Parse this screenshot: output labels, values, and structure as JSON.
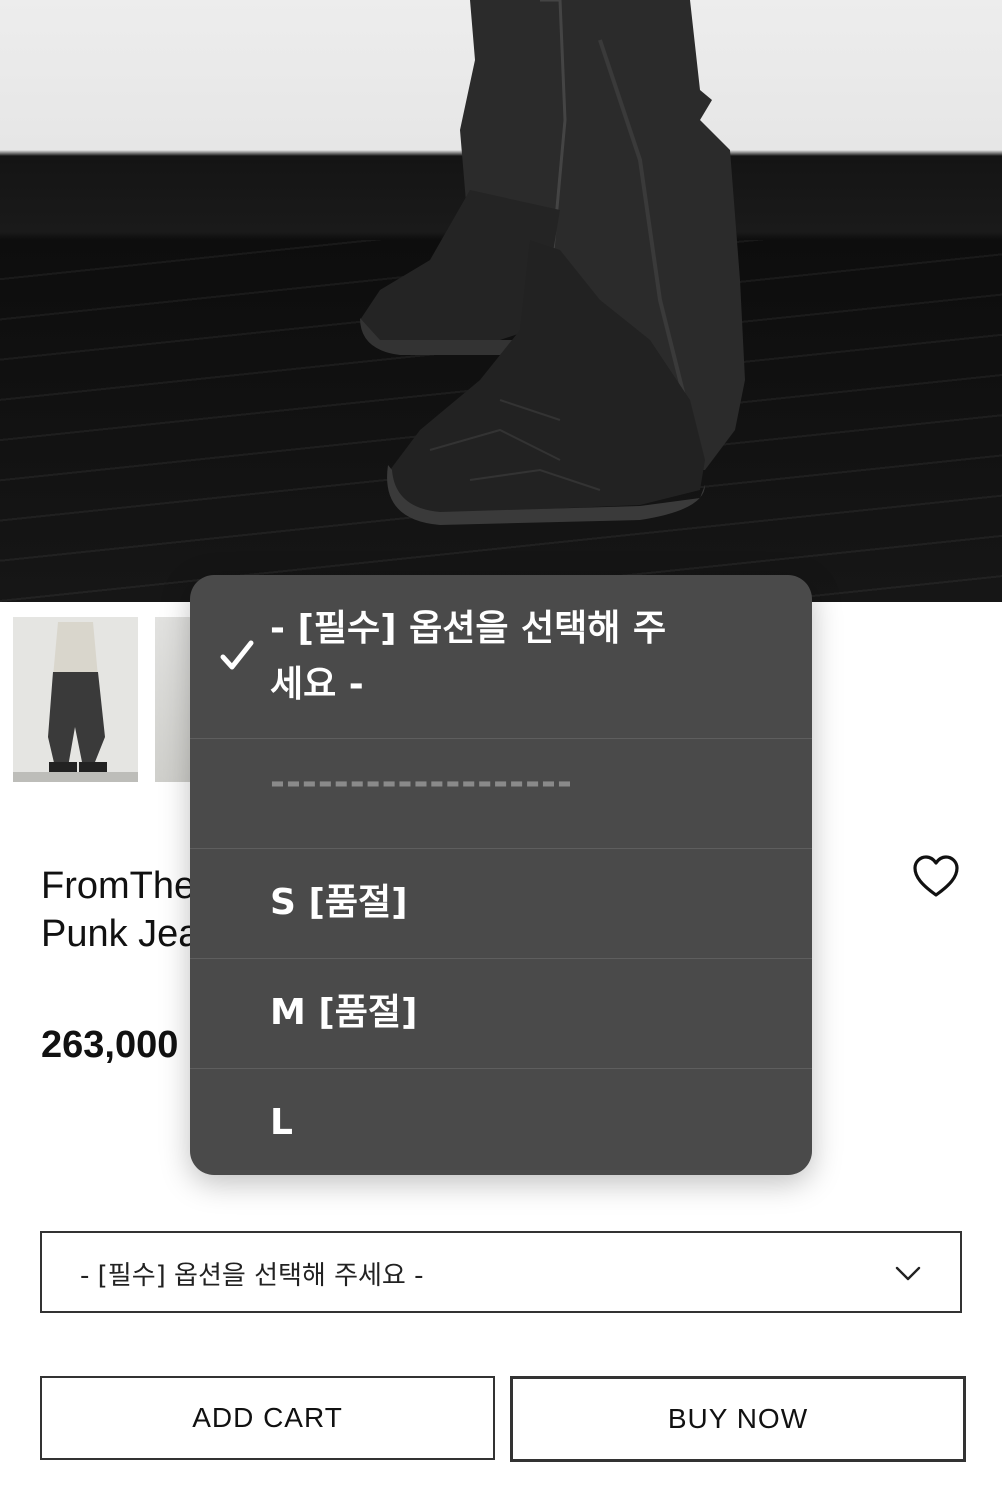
{
  "product": {
    "title_line1": "FromThe",
    "title_line1_tail": "e",
    "title_line2": "Punk Jea",
    "price": "263,000"
  },
  "option_select": {
    "value": "- [필수] 옵션을 선택해 주세요 -"
  },
  "buttons": {
    "add_cart": "ADD CART",
    "buy_now": "BUY NOW"
  },
  "dropdown": {
    "options": [
      {
        "label": "- [필수] 옵션을 선택해 주세요 -",
        "selected": true
      },
      {
        "label": "-------------------",
        "selected": false
      },
      {
        "label": "S [품절]",
        "selected": false
      },
      {
        "label": "M [품절]",
        "selected": false
      },
      {
        "label": "L",
        "selected": false
      }
    ]
  },
  "icons": {
    "wishlist": "heart-outline-icon",
    "select_arrow": "chevron-down-icon",
    "selected_mark": "checkmark-icon"
  },
  "colors": {
    "popup_bg": "#4a4a4a",
    "popup_text": "#ffffff",
    "separator_text": "#8a8a8a",
    "border": "#333333"
  }
}
